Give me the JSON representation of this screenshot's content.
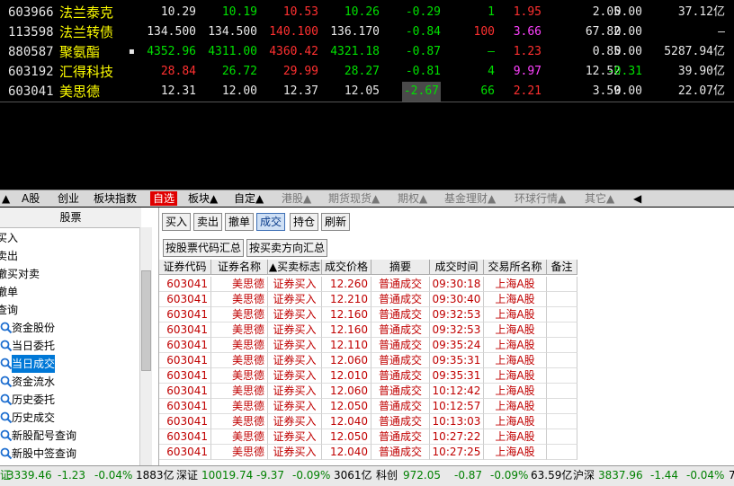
{
  "quotes": [
    {
      "code": "603966",
      "name": "法兰泰克",
      "flag": "",
      "v1": "10.29",
      "v2": "10.19",
      "v3": "10.53",
      "v4": "10.26",
      "chg": "-0.29",
      "vol": "1",
      "v7": "1.95",
      "v8": "2.05",
      "v9": "0.00",
      "amt": "37.12亿"
    },
    {
      "code": "113598",
      "name": "法兰转债",
      "flag": "",
      "v1": "134.500",
      "v2": "134.500",
      "v3": "140.100",
      "v4": "136.170",
      "chg": "-0.84",
      "vol": "100",
      "v7": "3.66",
      "v8": "67.82",
      "v9": "0.00",
      "amt": "–"
    },
    {
      "code": "880587",
      "name": "聚氨酯",
      "flag": "▪",
      "v1": "4352.96",
      "v2": "4311.00",
      "v3": "4360.42",
      "v4": "4321.18",
      "chg": "-0.87",
      "vol": "–",
      "v7": "1.23",
      "v8": "0.85",
      "v9": "0.00",
      "amt": "5287.94亿"
    },
    {
      "code": "603192",
      "name": "汇得科技",
      "flag": "",
      "v1": "28.84",
      "v2": "26.72",
      "v3": "29.99",
      "v4": "28.27",
      "chg": "-0.81",
      "vol": "4",
      "v7": "9.97",
      "v8": "12.52",
      "v9": "-0.31",
      "amt": "39.90亿"
    },
    {
      "code": "603041",
      "name": "美思德",
      "flag": "",
      "v1": "12.31",
      "v2": "12.00",
      "v3": "12.37",
      "v4": "12.05",
      "chg": "-2.67",
      "vol": "66",
      "v7": "2.21",
      "v8": "3.59",
      "v9": "0.00",
      "amt": "22.07亿"
    }
  ],
  "tabs": [
    "▲",
    "A股",
    "创业",
    "板块指数",
    "自选",
    "板块▲",
    "自定▲",
    "港股▲",
    "期货现货▲",
    "期权▲",
    "基金理财▲",
    "环球行情▲",
    "其它▲",
    "◀"
  ],
  "active_tab": "自选",
  "left_panel": {
    "title": "股票",
    "items": [
      "买入",
      "卖出",
      "撤买对卖",
      "撤单",
      "查询"
    ],
    "sub_items": [
      "资金股份",
      "当日委托",
      "当日成交",
      "资金流水",
      "历史委托",
      "历史成交",
      "新股配号查询",
      "新股中签查询"
    ],
    "selected": "当日成交"
  },
  "actions": [
    "买入",
    "卖出",
    "撤单",
    "成交",
    "持仓",
    "刷新"
  ],
  "active_action": "成交",
  "summary_buttons": [
    "按股票代码汇总",
    "按买卖方向汇总"
  ],
  "table": {
    "headers": [
      "证券代码",
      "证券名称",
      "▲买卖标志",
      "成交价格",
      "摘要",
      "成交时间",
      "交易所名称",
      "备注"
    ],
    "rows": [
      [
        "603041",
        "美思德",
        "证券买入",
        "12.260",
        "普通成交",
        "09:30:18",
        "上海A股",
        ""
      ],
      [
        "603041",
        "美思德",
        "证券买入",
        "12.210",
        "普通成交",
        "09:30:40",
        "上海A股",
        ""
      ],
      [
        "603041",
        "美思德",
        "证券买入",
        "12.160",
        "普通成交",
        "09:32:53",
        "上海A股",
        ""
      ],
      [
        "603041",
        "美思德",
        "证券买入",
        "12.160",
        "普通成交",
        "09:32:53",
        "上海A股",
        ""
      ],
      [
        "603041",
        "美思德",
        "证券买入",
        "12.110",
        "普通成交",
        "09:35:24",
        "上海A股",
        ""
      ],
      [
        "603041",
        "美思德",
        "证券买入",
        "12.060",
        "普通成交",
        "09:35:31",
        "上海A股",
        ""
      ],
      [
        "603041",
        "美思德",
        "证券买入",
        "12.010",
        "普通成交",
        "09:35:31",
        "上海A股",
        ""
      ],
      [
        "603041",
        "美思德",
        "证券买入",
        "12.060",
        "普通成交",
        "10:12:42",
        "上海A股",
        ""
      ],
      [
        "603041",
        "美思德",
        "证券买入",
        "12.050",
        "普通成交",
        "10:12:57",
        "上海A股",
        ""
      ],
      [
        "603041",
        "美思德",
        "证券买入",
        "12.040",
        "普通成交",
        "10:13:03",
        "上海A股",
        ""
      ],
      [
        "603041",
        "美思德",
        "证券买入",
        "12.050",
        "普通成交",
        "10:27:22",
        "上海A股",
        ""
      ],
      [
        "603041",
        "美思德",
        "证券买入",
        "12.040",
        "普通成交",
        "10:27:25",
        "上海A股",
        ""
      ]
    ]
  },
  "status_bar": {
    "sh_name": "证",
    "sh_val": "3339.46",
    "sh_chg": "-1.23",
    "sh_pct": "-0.04%",
    "sh_amt": "1883亿",
    "sz_name": "深证",
    "sz_val": "10019.74",
    "sz_chg": "-9.37",
    "sz_pct": "-0.09%",
    "sz_amt": "3061亿",
    "kc_name": "科创",
    "kc_val": "972.05",
    "kc_chg": "-0.87",
    "kc_pct": "-0.09%",
    "kc_amt": "63.59亿",
    "hs_name": "沪深",
    "hs_val": "3837.96",
    "hs_chg": "-1.44",
    "hs_pct": "-0.04%",
    "tail": "7"
  }
}
